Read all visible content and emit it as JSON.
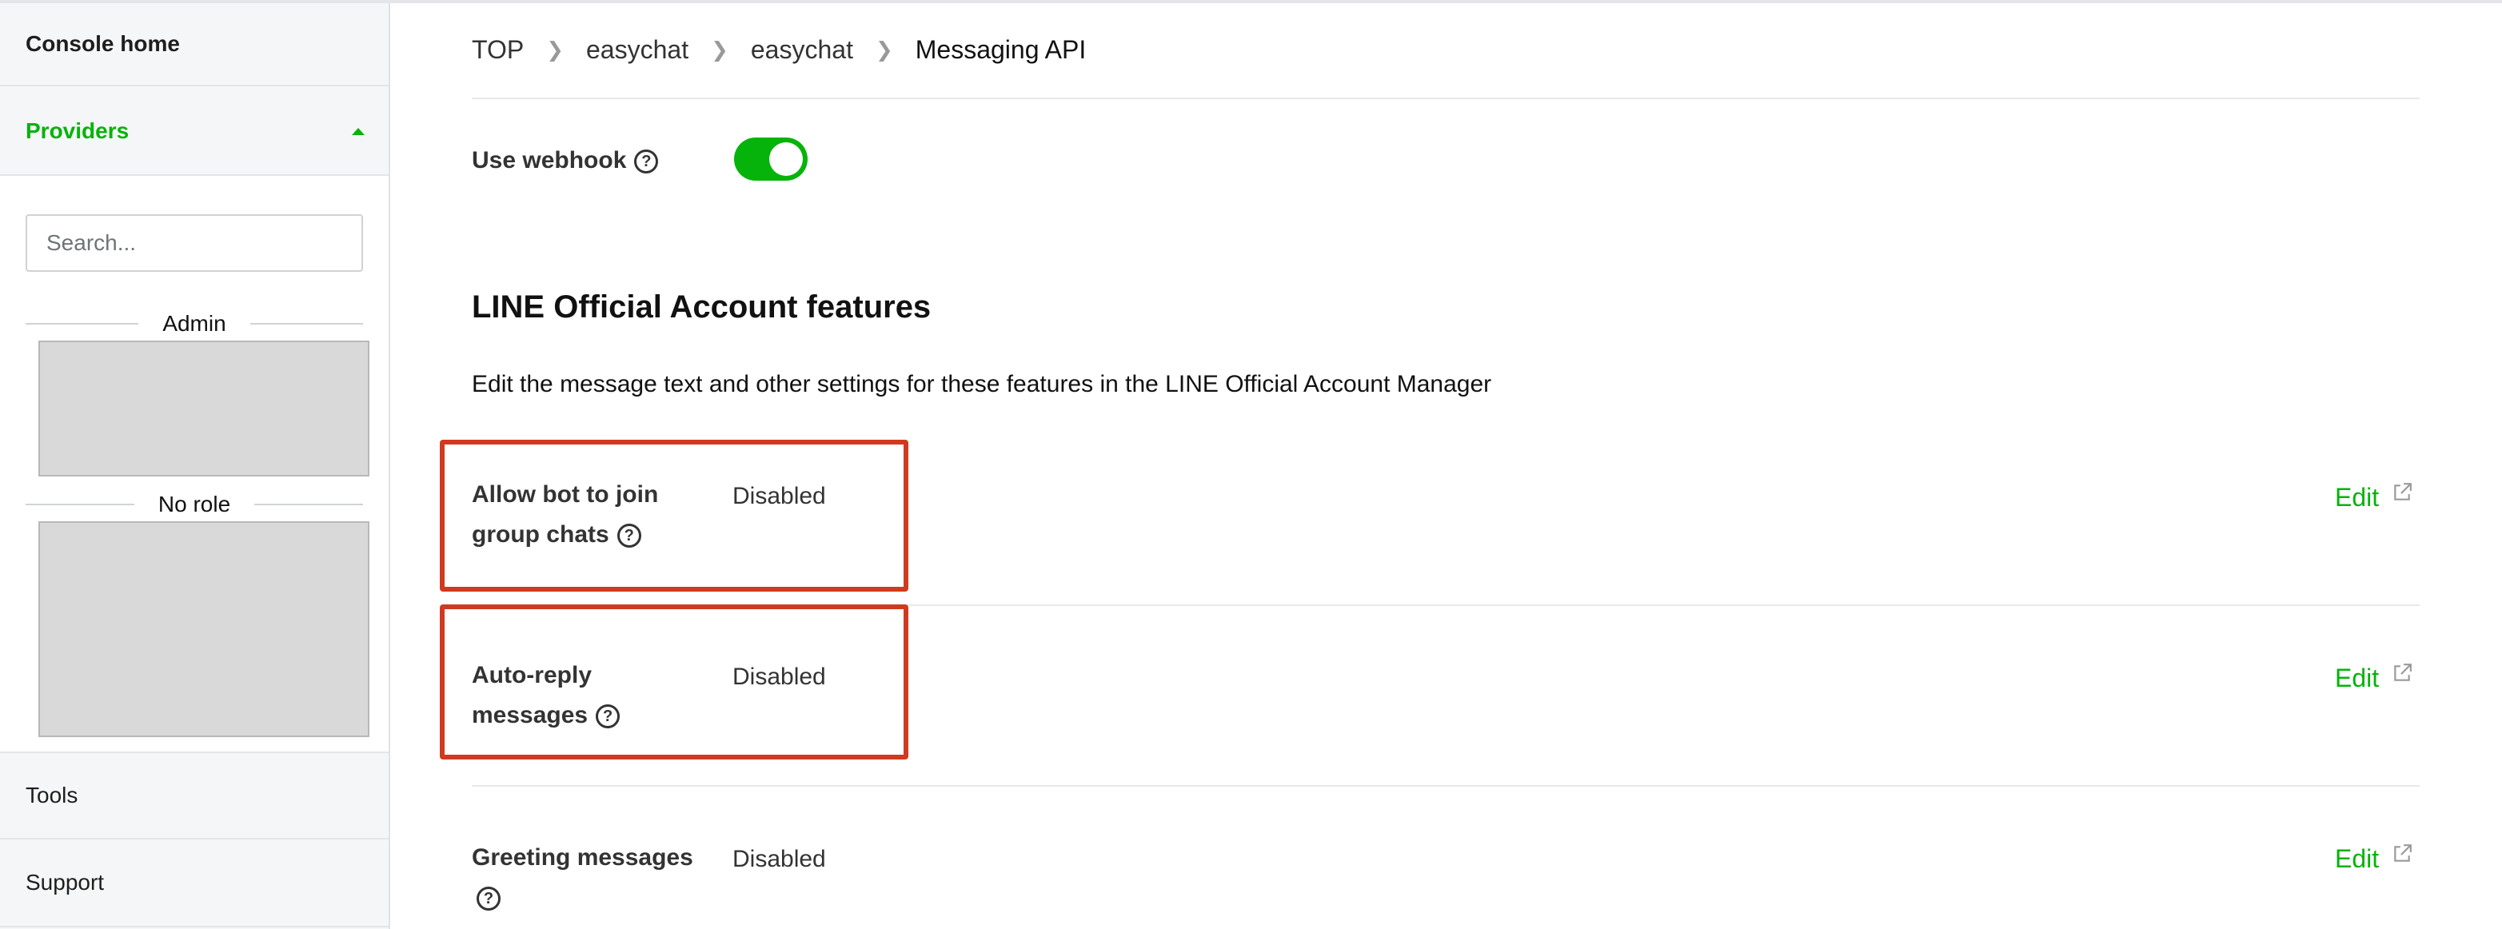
{
  "sidebar": {
    "console_home": "Console home",
    "providers": "Providers",
    "search_placeholder": "Search...",
    "groups": [
      {
        "label": "Admin"
      },
      {
        "label": "No role"
      }
    ],
    "tools": "Tools",
    "support": "Support"
  },
  "breadcrumb": [
    "TOP",
    "easychat",
    "easychat",
    "Messaging API"
  ],
  "webhook": {
    "label": "Use webhook",
    "enabled": true
  },
  "section": {
    "title": "LINE Official Account features",
    "description": "Edit the message text and other settings for these features in the LINE Official Account Manager"
  },
  "features": [
    {
      "label_line1": "Allow bot to join",
      "label_line2": "group chats",
      "value": "Disabled",
      "edit": "Edit"
    },
    {
      "label_line1": "Auto-reply",
      "label_line2": "messages",
      "value": "Disabled",
      "edit": "Edit"
    },
    {
      "label_line1": "Greeting messages",
      "label_line2": "",
      "value": "Disabled",
      "edit": "Edit"
    }
  ],
  "colors": {
    "accent": "#06b30a",
    "highlight": "#d03a1f"
  }
}
